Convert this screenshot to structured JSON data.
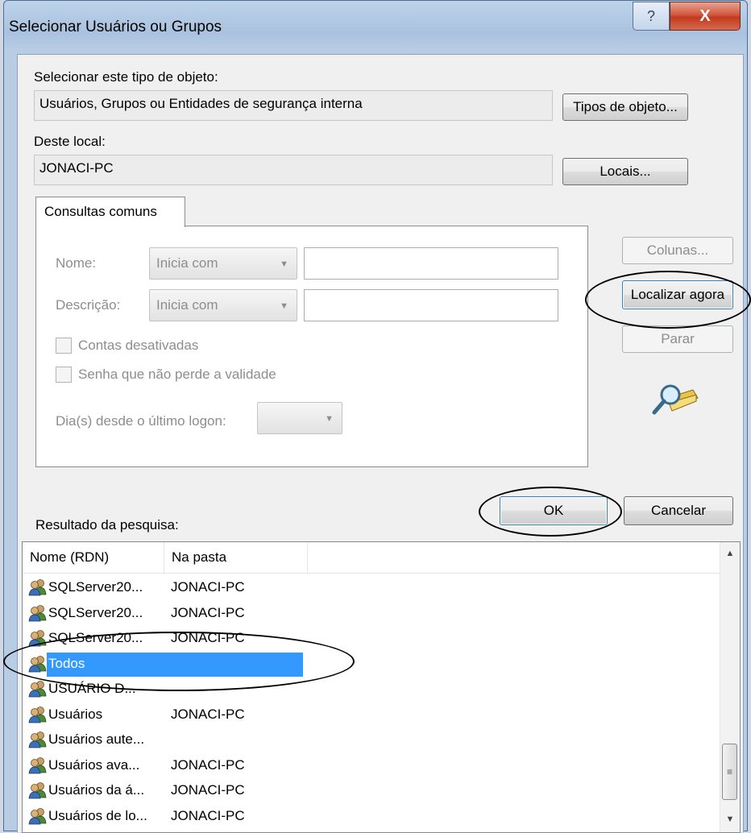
{
  "window": {
    "title": "Selecionar Usuários ou Grupos",
    "help_glyph": "?",
    "close_glyph": "X"
  },
  "object_type": {
    "label": "Selecionar este tipo de objeto:",
    "value": "Usuários, Grupos ou Entidades de segurança interna",
    "button": "Tipos de objeto..."
  },
  "location": {
    "label": "Deste local:",
    "value": "JONACI-PC",
    "button": "Locais..."
  },
  "query": {
    "tab_label": "Consultas comuns",
    "name_label": "Nome:",
    "name_operator": "Inicia com",
    "description_label": "Descrição:",
    "description_operator": "Inicia com",
    "disabled_accounts_label": "Contas desativadas",
    "non_expiring_password_label": "Senha que não perde a validade",
    "days_since_logon_label": "Dia(s) desde o último logon:"
  },
  "actions": {
    "columns": "Colunas...",
    "find_now": "Localizar agora",
    "stop": "Parar",
    "ok": "OK",
    "cancel": "Cancelar"
  },
  "results": {
    "label": "Resultado da pesquisa:",
    "columns": [
      "Nome (RDN)",
      "Na pasta"
    ],
    "rows": [
      {
        "name": "SQLServer20...",
        "folder": "JONACI-PC"
      },
      {
        "name": "SQLServer20...",
        "folder": "JONACI-PC"
      },
      {
        "name": "SQLServer20...",
        "folder": "JONACI-PC"
      },
      {
        "name": "Todos",
        "folder": ""
      },
      {
        "name": "USUÁRIO D...",
        "folder": ""
      },
      {
        "name": "Usuários",
        "folder": "JONACI-PC"
      },
      {
        "name": "Usuários aute...",
        "folder": ""
      },
      {
        "name": "Usuários ava...",
        "folder": "JONACI-PC"
      },
      {
        "name": "Usuários da á...",
        "folder": "JONACI-PC"
      },
      {
        "name": "Usuários de lo...",
        "folder": "JONACI-PC"
      }
    ],
    "selected_row": "Todos"
  },
  "icons": {
    "group": "users-group-icon",
    "search": "search-folder-icon"
  },
  "colors": {
    "selection": "#3399ff",
    "title_bar": "#bfd3ea",
    "close_button": "#c23a1e"
  }
}
